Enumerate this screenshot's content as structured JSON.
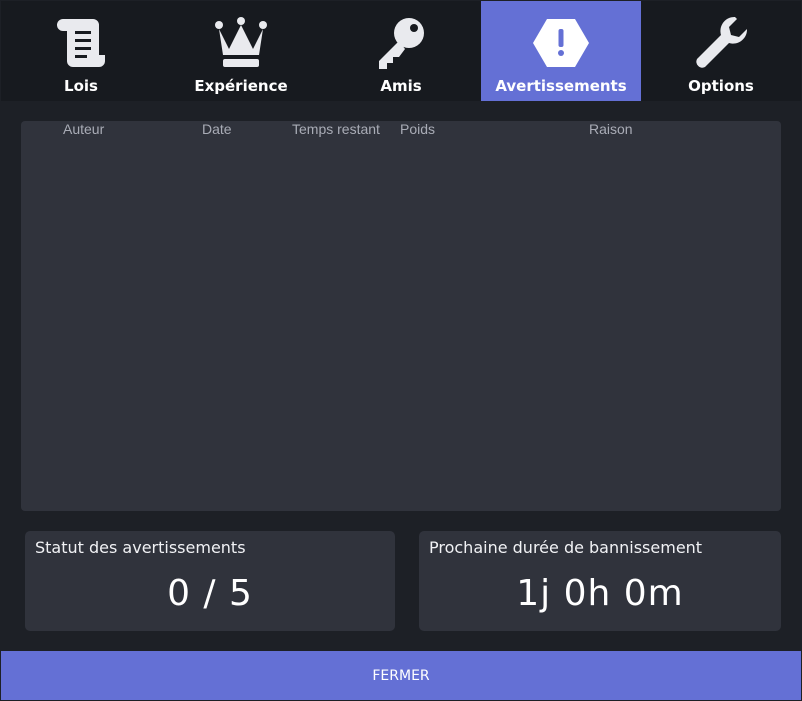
{
  "tabs": [
    {
      "label": "Lois",
      "icon": "scroll-icon",
      "active": false
    },
    {
      "label": "Expérience",
      "icon": "crown-icon",
      "active": false
    },
    {
      "label": "Amis",
      "icon": "key-icon",
      "active": false
    },
    {
      "label": "Avertissements",
      "icon": "warning-icon",
      "active": true
    },
    {
      "label": "Options",
      "icon": "wrench-icon",
      "active": false
    }
  ],
  "table": {
    "columns": [
      "Auteur",
      "Date",
      "Temps restant",
      "Poids",
      "Raison"
    ],
    "rows": []
  },
  "status": {
    "title": "Statut des avertissements",
    "value": "0 / 5"
  },
  "next_ban": {
    "title": "Prochaine durée de bannissement",
    "value": "1j 0h 0m"
  },
  "close_label": "FERMER",
  "colors": {
    "accent": "#6470d5",
    "background": "#1d2026",
    "panel": "#30333c",
    "tabbar": "#171a1f"
  }
}
